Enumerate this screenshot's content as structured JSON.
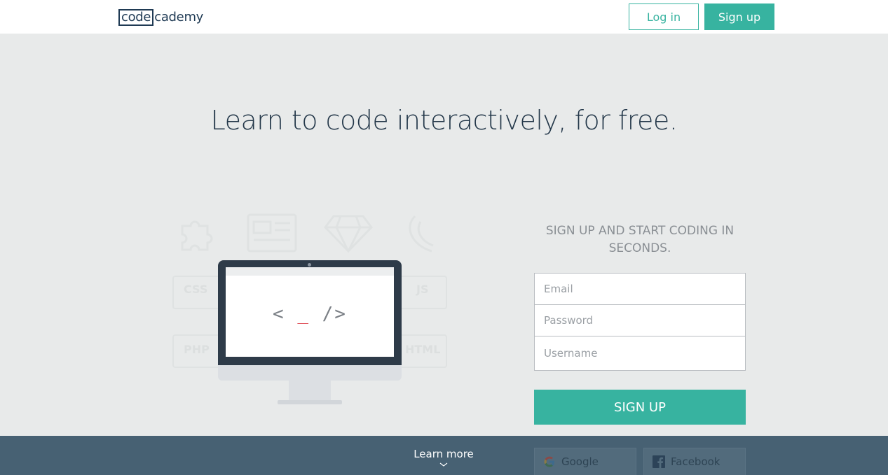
{
  "header": {
    "logo_boxed": "code",
    "logo_rest": "cademy",
    "login_label": "Log in",
    "signup_label": "Sign up"
  },
  "hero": {
    "title": "Learn to code interactively, for free."
  },
  "illustration": {
    "code_open": "< ",
    "code_cursor": "_",
    "code_close": " />",
    "ghost_labels": [
      "CSS",
      "JS",
      "PHP",
      "HTML"
    ]
  },
  "signup": {
    "heading": "SIGN UP AND START CODING IN SECONDS.",
    "email_placeholder": "Email",
    "password_placeholder": "Password",
    "username_placeholder": "Username",
    "button_label": "SIGN UP"
  },
  "footer": {
    "learn_more": "Learn more",
    "google_label": "Google",
    "facebook_label": "Facebook"
  },
  "colors": {
    "accent": "#37b3a0",
    "navy": "#24384a",
    "band": "#476173",
    "background": "#e8eaea"
  }
}
